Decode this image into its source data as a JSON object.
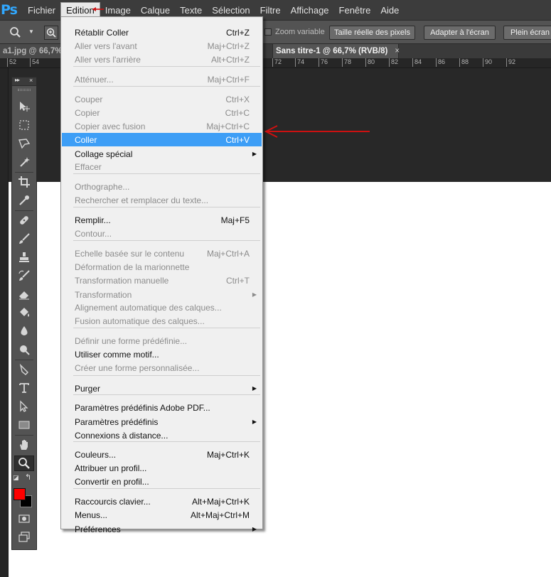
{
  "app": {
    "logo": "Ps"
  },
  "menubar": {
    "items": [
      "Fichier",
      "Edition",
      "Image",
      "Calque",
      "Texte",
      "Sélection",
      "Filtre",
      "Affichage",
      "Fenêtre",
      "Aide"
    ],
    "active": "Edition"
  },
  "options_bar": {
    "zoom_in_symbol": "⊕",
    "zoom_variable_label": "Zoom variable",
    "btn_actual_pixels": "Taille réelle des pixels",
    "btn_fit_screen": "Adapter à l'écran",
    "btn_full_screen": "Plein écran"
  },
  "tabs": {
    "tab1_title": "a1.jpg @ 66,7%",
    "tab2_title": "Sans titre-1 @ 66,7% (RVB/8)",
    "tab2_close": "×"
  },
  "ruler": {
    "labels": [
      "52",
      "54",
      "72",
      "74",
      "76",
      "78",
      "80",
      "82",
      "84",
      "86",
      "88",
      "90",
      "92"
    ]
  },
  "tools_panel": {
    "collapse_glyph": "▸▸",
    "close_glyph": "×",
    "tools": [
      "move-tool",
      "marquee-tool",
      "lasso-tool",
      "magic-wand-tool",
      "crop-tool",
      "eyedropper-tool",
      "healing-brush-tool",
      "brush-tool",
      "clone-stamp-tool",
      "history-brush-tool",
      "eraser-tool",
      "paint-bucket-tool",
      "blur-tool",
      "dodge-tool",
      "pen-tool",
      "type-tool",
      "path-selection-tool",
      "rectangle-tool",
      "hand-tool",
      "zoom-tool",
      "quick-mask",
      "screen-mode"
    ],
    "selected_tool": "zoom-tool",
    "foreground_color": "#ff0000",
    "background_color": "#000000"
  },
  "edition_menu": {
    "items": [
      {
        "label": "Rétablir Coller",
        "shortcut": "Ctrl+Z",
        "enabled": true
      },
      {
        "label": "Aller vers l'avant",
        "shortcut": "Maj+Ctrl+Z",
        "enabled": false
      },
      {
        "label": "Aller vers l'arrière",
        "shortcut": "Alt+Ctrl+Z",
        "enabled": false
      },
      {
        "label": "Atténuer...",
        "shortcut": "Maj+Ctrl+F",
        "enabled": false
      },
      {
        "label": "Couper",
        "shortcut": "Ctrl+X",
        "enabled": false
      },
      {
        "label": "Copier",
        "shortcut": "Ctrl+C",
        "enabled": false
      },
      {
        "label": "Copier avec fusion",
        "shortcut": "Maj+Ctrl+C",
        "enabled": false
      },
      {
        "label": "Coller",
        "shortcut": "Ctrl+V",
        "enabled": true,
        "highlighted": true
      },
      {
        "label": "Collage spécial",
        "shortcut": "",
        "enabled": true,
        "submenu": true
      },
      {
        "label": "Effacer",
        "shortcut": "",
        "enabled": false
      },
      {
        "label": "Orthographe...",
        "shortcut": "",
        "enabled": false
      },
      {
        "label": "Rechercher et remplacer du texte...",
        "shortcut": "",
        "enabled": false
      },
      {
        "label": "Remplir...",
        "shortcut": "Maj+F5",
        "enabled": true
      },
      {
        "label": "Contour...",
        "shortcut": "",
        "enabled": false
      },
      {
        "label": "Echelle basée sur le contenu",
        "shortcut": "Maj+Ctrl+A",
        "enabled": false
      },
      {
        "label": "Déformation de la marionnette",
        "shortcut": "",
        "enabled": false
      },
      {
        "label": "Transformation manuelle",
        "shortcut": "Ctrl+T",
        "enabled": false
      },
      {
        "label": "Transformation",
        "shortcut": "",
        "enabled": false,
        "submenu": true
      },
      {
        "label": "Alignement automatique des calques...",
        "shortcut": "",
        "enabled": false
      },
      {
        "label": "Fusion automatique des calques...",
        "shortcut": "",
        "enabled": false
      },
      {
        "label": "Définir une forme prédéfinie...",
        "shortcut": "",
        "enabled": false
      },
      {
        "label": "Utiliser comme motif...",
        "shortcut": "",
        "enabled": true
      },
      {
        "label": "Créer une forme personnalisée...",
        "shortcut": "",
        "enabled": false
      },
      {
        "label": "Purger",
        "shortcut": "",
        "enabled": true,
        "submenu": true
      },
      {
        "label": "Paramètres prédéfinis Adobe PDF...",
        "shortcut": "",
        "enabled": true
      },
      {
        "label": "Paramètres prédéfinis",
        "shortcut": "",
        "enabled": true,
        "submenu": true
      },
      {
        "label": "Connexions à distance...",
        "shortcut": "",
        "enabled": true
      },
      {
        "label": "Couleurs...",
        "shortcut": "Maj+Ctrl+K",
        "enabled": true
      },
      {
        "label": "Attribuer un profil...",
        "shortcut": "",
        "enabled": true
      },
      {
        "label": "Convertir en profil...",
        "shortcut": "",
        "enabled": true
      },
      {
        "label": "Raccourcis clavier...",
        "shortcut": "Alt+Maj+Ctrl+K",
        "enabled": true
      },
      {
        "label": "Menus...",
        "shortcut": "Alt+Maj+Ctrl+M",
        "enabled": true
      },
      {
        "label": "Préférences",
        "shortcut": "",
        "enabled": true,
        "submenu": true
      }
    ]
  },
  "annotation": {
    "arrow_color": "#cc1111"
  }
}
